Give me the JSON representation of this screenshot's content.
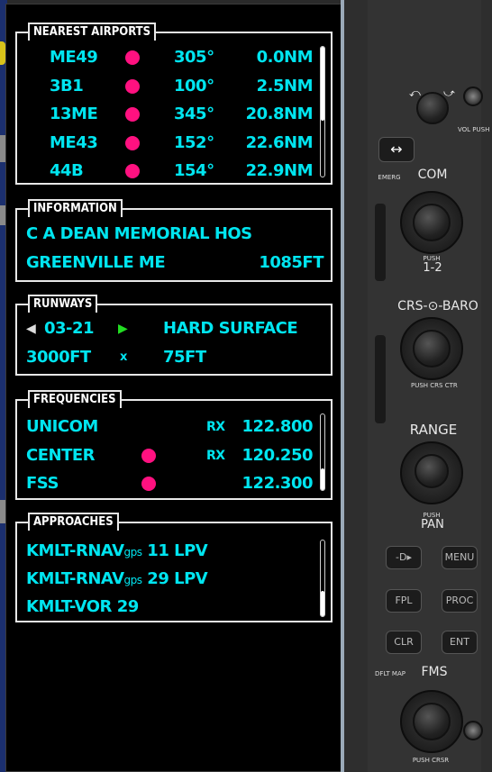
{
  "nearest_airports": {
    "title": "NEAREST AIRPORTS",
    "rows": [
      {
        "id": "ME49",
        "bearing": "305°",
        "distance": "0.0NM"
      },
      {
        "id": "3B1",
        "bearing": "100°",
        "distance": "2.5NM"
      },
      {
        "id": "13ME",
        "bearing": "345°",
        "distance": "20.8NM"
      },
      {
        "id": "ME43",
        "bearing": "152°",
        "distance": "22.6NM"
      },
      {
        "id": "44B",
        "bearing": "154°",
        "distance": "22.9NM"
      }
    ]
  },
  "information": {
    "title": "INFORMATION",
    "name": "C A DEAN MEMORIAL HOS",
    "city": "GREENVILLE ME",
    "elevation": "1085FT"
  },
  "runways": {
    "title": "RUNWAYS",
    "designation": "03-21",
    "surface": "HARD SURFACE",
    "length": "3000FT",
    "by": "x",
    "width": "75FT"
  },
  "frequencies": {
    "title": "FREQUENCIES",
    "rows": [
      {
        "name": "UNICOM",
        "rx": "RX",
        "freq": "122.800",
        "dot": false
      },
      {
        "name": "CENTER",
        "rx": "RX",
        "freq": "120.250",
        "dot": true
      },
      {
        "name": "FSS",
        "rx": "",
        "freq": "122.300",
        "dot": true
      }
    ]
  },
  "approaches": {
    "title": "APPROACHES",
    "rows": [
      {
        "a": "KMLT-RNAV",
        "sub": "gps",
        "b": " 11 LPV"
      },
      {
        "a": "KMLT-RNAV",
        "sub": "gps",
        "b": " 29 LPV"
      },
      {
        "a": "KMLT-VOR 29",
        "sub": "",
        "b": ""
      }
    ]
  },
  "bezel": {
    "vol_push_sq": "VOL PUSH SQ",
    "emerg": "EMERG",
    "swap_icon": "↔",
    "com": "COM",
    "push_12_small": "PUSH",
    "push_12": "1-2",
    "crs_baro": "CRS-⊙-BARO",
    "push_crs_ctr": "PUSH CRS CTR",
    "range": "RANGE",
    "push_pan_small": "PUSH",
    "pan": "PAN",
    "direct_to": "-D▸",
    "menu": "MENU",
    "fpl": "FPL",
    "proc": "PROC",
    "clr": "CLR",
    "ent": "ENT",
    "dflt_map": "DFLT MAP",
    "fms": "FMS",
    "push_crsr": "PUSH CRSR"
  },
  "colors": {
    "text_cyan": "#00e5f0",
    "dot_magenta": "#ff1180",
    "green_arrow": "#22dd22"
  }
}
